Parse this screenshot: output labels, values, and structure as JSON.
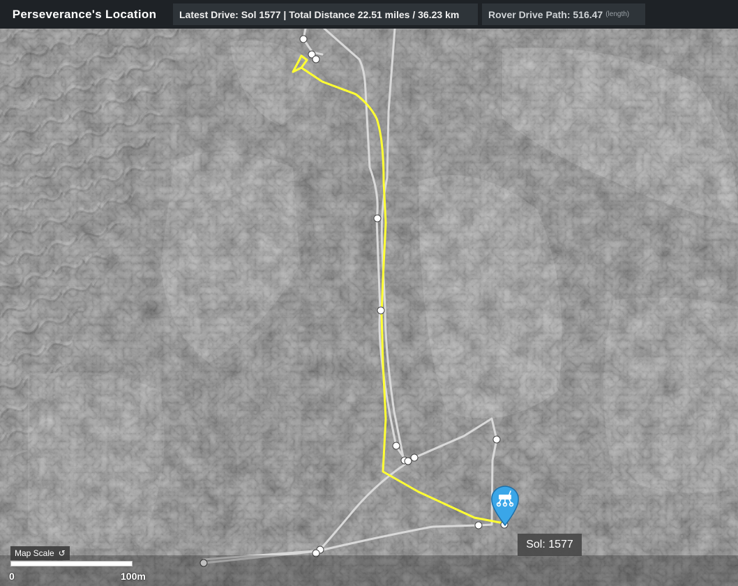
{
  "header": {
    "title": "Perseverance's Location",
    "latest_drive": "Latest Drive: Sol 1577 | Total Distance 22.51 miles / 36.23 km",
    "drive_path_label": "Rover Drive Path: 516.47",
    "drive_path_unit": "(length)"
  },
  "map": {
    "current_sol_label": "Sol: 1577",
    "scale": {
      "button_label": "Map Scale",
      "button_icon": "undo-arrow-icon",
      "min_label": "0",
      "max_label": "100m"
    },
    "rover_marker_icon": "rover-icon",
    "colors": {
      "latest_drive_path": "#ffff33",
      "previous_paths": "#d9d9d9",
      "waypoint": "#ffffff",
      "marker": "#3aa6e8"
    }
  }
}
